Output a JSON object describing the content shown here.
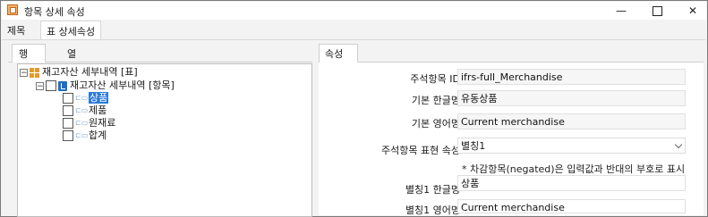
{
  "window": {
    "title": "항목 상세 속성"
  },
  "top_tabs": [
    {
      "label": "제목"
    },
    {
      "label": "표 상세속성"
    }
  ],
  "left": {
    "tabs": [
      {
        "label": "행"
      },
      {
        "label": "열"
      }
    ],
    "tree": {
      "root": "재고자산 세부내역 [표]",
      "child": "재고자산 세부내역 [항목]",
      "items": [
        "상품",
        "제품",
        "원재료",
        "합계"
      ]
    }
  },
  "right": {
    "tab": "속성",
    "fields": {
      "id": {
        "label": "주석항목 ID",
        "value": "ifrs-full_Merchandise"
      },
      "kor": {
        "label": "기본 한글명",
        "value": "유동상품"
      },
      "eng": {
        "label": "기본 영어명",
        "value": "Current merchandise"
      },
      "expr": {
        "label": "주석항목 표현 속성",
        "value": "별칭1"
      },
      "note": "* 차감항목(negated)은 입력값과 반대의 부호로 표시",
      "alias_kor": {
        "label": "별칭1 한글명",
        "value": "상품"
      },
      "alias_eng": {
        "label": "별칭1 영어명",
        "value": "Current merchandise"
      }
    }
  }
}
